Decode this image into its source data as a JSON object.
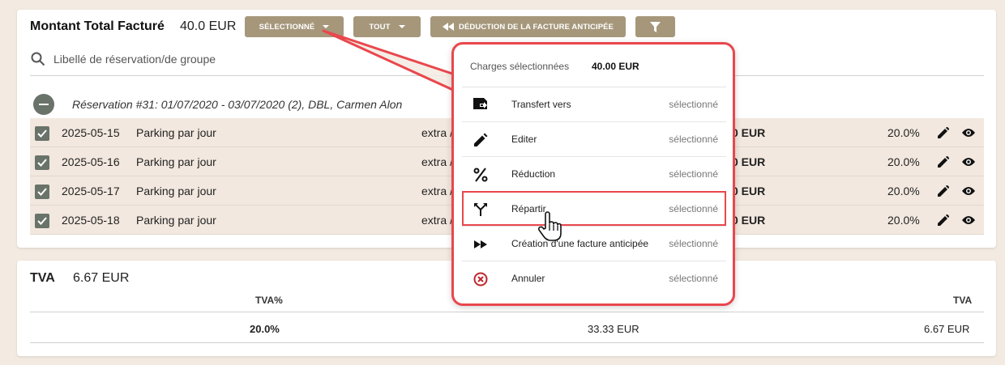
{
  "invoice": {
    "title": "Montant Total Facturé",
    "total": "40.0 EUR",
    "buttons": {
      "selected": "SÉLECTIONNÉ",
      "all": "TOUT",
      "deduction": "DÉDUCTION DE LA FACTURE ANTICIPÉE"
    },
    "search_placeholder": "Libellé de réservation/de groupe",
    "reservation": "Réservation #31: 01/07/2020 - 03/07/2020 (2), DBL, Carmen Alon",
    "rows": [
      {
        "date": "2025-05-15",
        "desc": "Parking par jour",
        "type": "extra /",
        "amount": "0 EUR",
        "vat": "20.0%",
        "checked": true
      },
      {
        "date": "2025-05-16",
        "desc": "Parking par jour",
        "type": "extra /",
        "amount": "0 EUR",
        "vat": "20.0%",
        "checked": true
      },
      {
        "date": "2025-05-17",
        "desc": "Parking par jour",
        "type": "extra /",
        "amount": "0 EUR",
        "vat": "20.0%",
        "checked": true
      },
      {
        "date": "2025-05-18",
        "desc": "Parking par jour",
        "type": "extra /",
        "amount": "0 EUR",
        "vat": "20.0%",
        "checked": true
      }
    ]
  },
  "tva": {
    "title": "TVA",
    "total": "6.67 EUR",
    "headers": [
      "TVA%",
      "",
      "TVA"
    ],
    "values": [
      "20.0%",
      "33.33 EUR",
      "6.67 EUR"
    ]
  },
  "menu": {
    "header_label": "Charges sélectionnées",
    "header_amount": "40.00 EUR",
    "items": [
      {
        "label": "Transfert vers",
        "status": "sélectionné",
        "icon": "transfer-icon"
      },
      {
        "label": "Editer",
        "status": "sélectionné",
        "icon": "pencil-icon"
      },
      {
        "label": "Réduction",
        "status": "sélectionné",
        "icon": "percent-icon"
      },
      {
        "label": "Répartir",
        "status": "sélectionné",
        "icon": "split-icon"
      },
      {
        "label": "Création d'une facture anticipée",
        "status": "sélectionné",
        "icon": "fast-forward-icon"
      },
      {
        "label": "Annuler",
        "status": "sélectionné",
        "icon": "cancel-icon"
      }
    ]
  },
  "colors": {
    "button": "#a6977b",
    "highlight": "#e9474d",
    "row_bg": "#f2e8df",
    "checkbox": "#69736a"
  }
}
